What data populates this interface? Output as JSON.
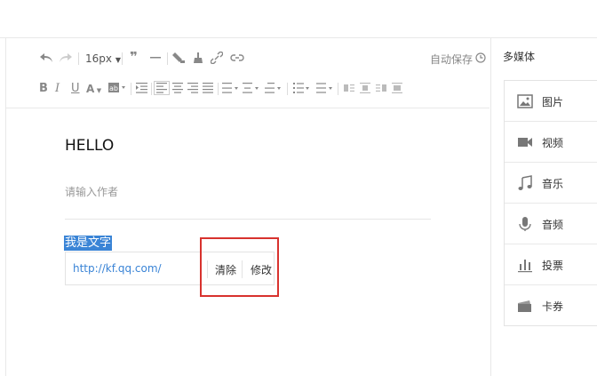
{
  "toolbar": {
    "font_size": "16px",
    "autosave_label": "自动保存"
  },
  "article": {
    "title": "HELLO",
    "author_placeholder": "请输入作者",
    "selected_text": "我是文字"
  },
  "link_popup": {
    "url": "http://kf.qq.com/",
    "clear_label": "清除",
    "edit_label": "修改"
  },
  "media_panel": {
    "title": "多媒体",
    "items": [
      {
        "label": "图片",
        "icon": "image-icon"
      },
      {
        "label": "视频",
        "icon": "video-icon"
      },
      {
        "label": "音乐",
        "icon": "music-icon"
      },
      {
        "label": "音频",
        "icon": "microphone-icon"
      },
      {
        "label": "投票",
        "icon": "vote-icon"
      },
      {
        "label": "卡券",
        "icon": "card-icon"
      }
    ]
  },
  "colors": {
    "accent": "#3a84d6",
    "highlight": "#d8322e"
  }
}
